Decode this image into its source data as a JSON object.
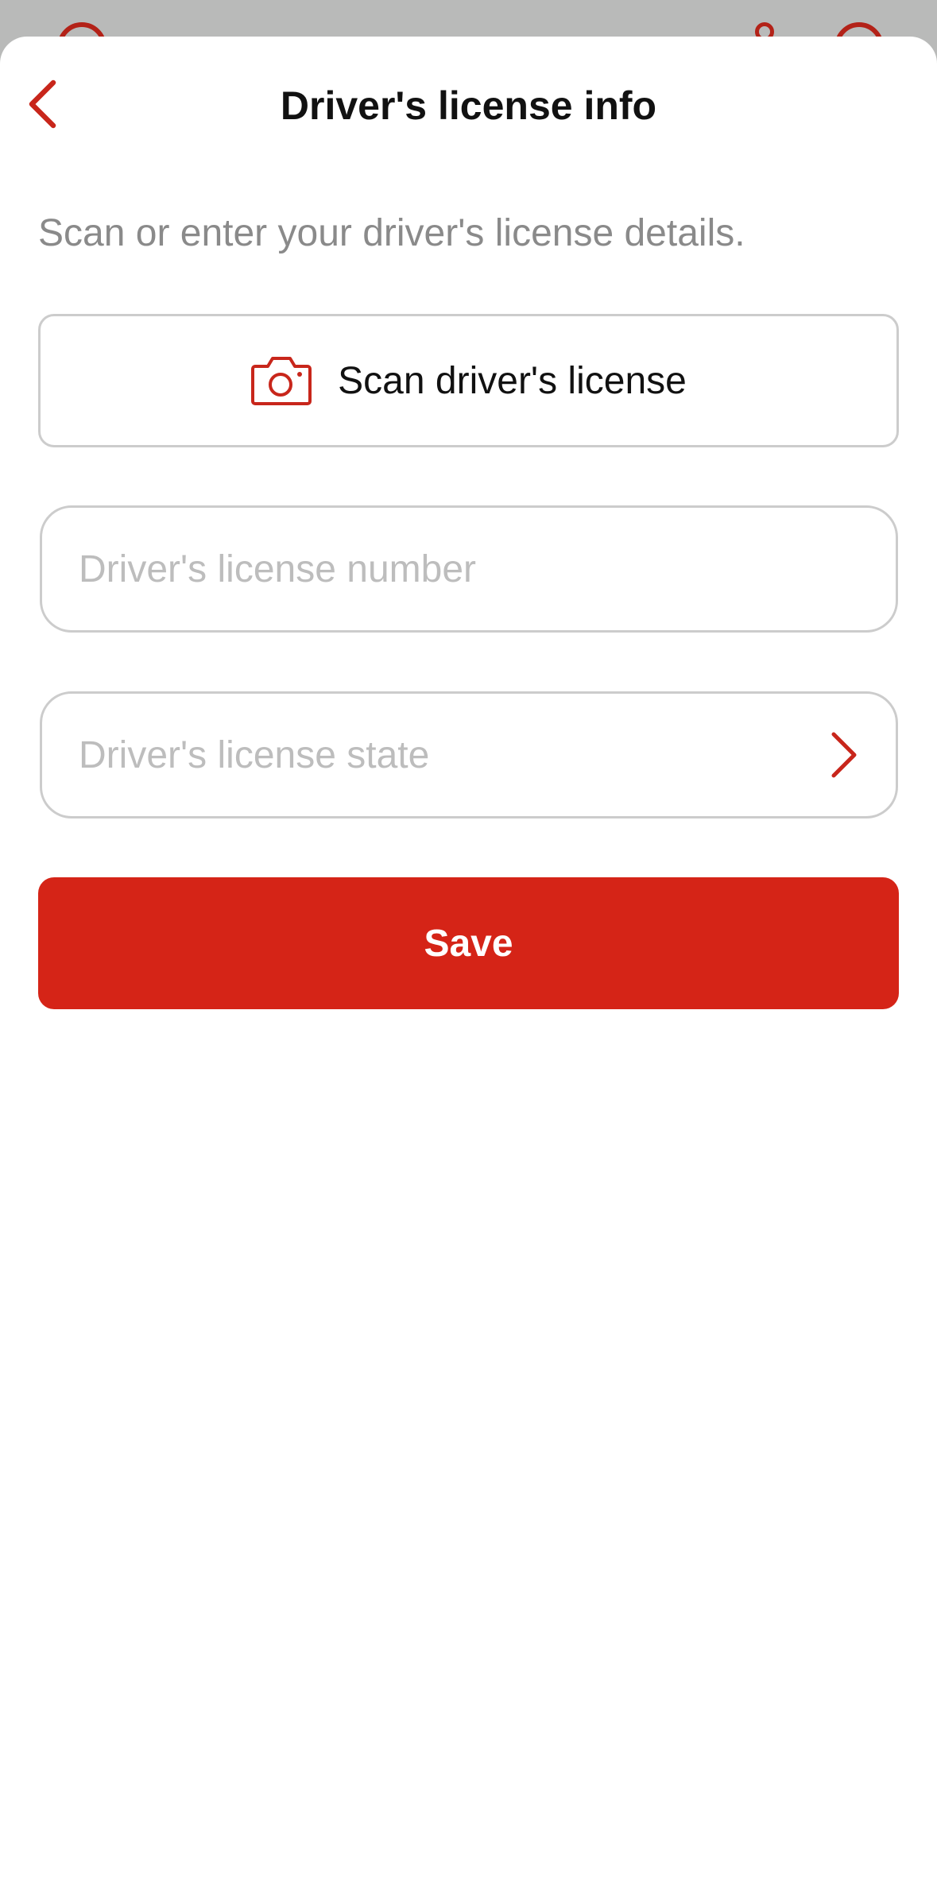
{
  "colors": {
    "accent": "#d52417",
    "icon_red": "#c8261b",
    "placeholder": "#bdbdbd",
    "subtitle": "#8a8a8a"
  },
  "header": {
    "title": "Driver's license info",
    "back_icon": "chevron-left-icon"
  },
  "subtitle": "Scan or enter your driver's license details.",
  "scan": {
    "label": "Scan driver's license",
    "icon": "camera-icon"
  },
  "fields": {
    "number_placeholder": "Driver's license number",
    "state_placeholder": "Driver's license state",
    "state_icon": "chevron-right-icon"
  },
  "save": {
    "label": "Save"
  }
}
